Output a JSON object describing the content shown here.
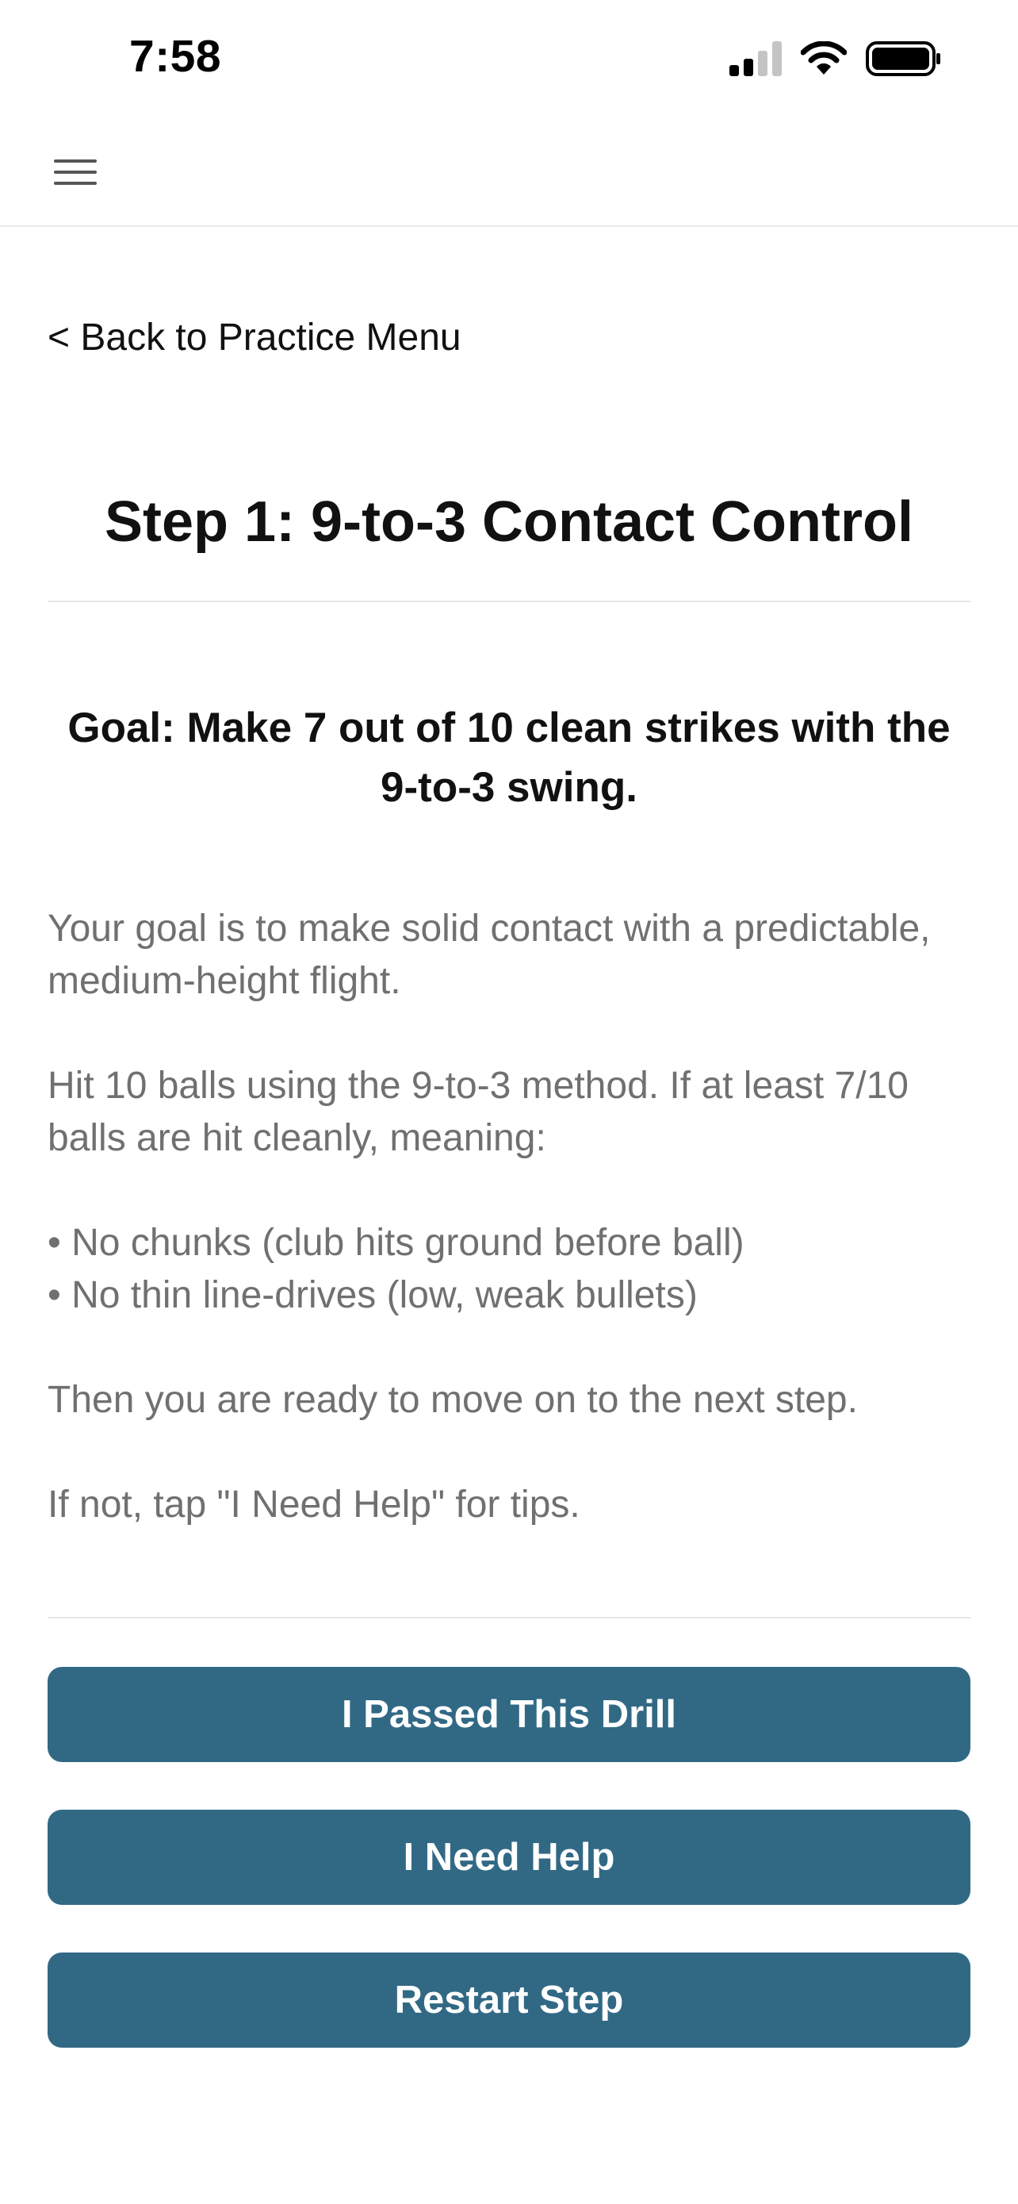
{
  "status_bar": {
    "time": "7:58",
    "icons": [
      "cellular-signal-icon",
      "wifi-icon",
      "battery-icon"
    ]
  },
  "nav": {
    "menu_icon": "hamburger-menu-icon"
  },
  "back_link": {
    "label": "< Back to Practice Menu"
  },
  "step": {
    "title": "Step 1: 9-to-3 Contact Control",
    "goal": "Goal: Make 7 out of 10 clean strikes with the 9-to-3 swing.",
    "paragraphs": [
      "Your goal is to make solid contact with a predictable, medium-height flight.",
      "Hit 10 balls using the 9-to-3 method. If at least 7/10 balls are hit cleanly, meaning:"
    ],
    "bullets": [
      "• No chunks (club hits ground before ball)",
      "• No thin line-drives (low, weak bullets)"
    ],
    "ready_text": "Then you are ready to move on to the next step.",
    "help_text": "If not, tap \"I Need Help\" for tips."
  },
  "actions": {
    "passed_label": "I Passed This Drill",
    "help_label": "I Need Help",
    "restart_label": "Restart Step"
  },
  "colors": {
    "button_bg": "#316985",
    "button_text": "#ffffff",
    "body_text": "#707070",
    "heading_text": "#111111",
    "divider": "#e6e6e6"
  }
}
